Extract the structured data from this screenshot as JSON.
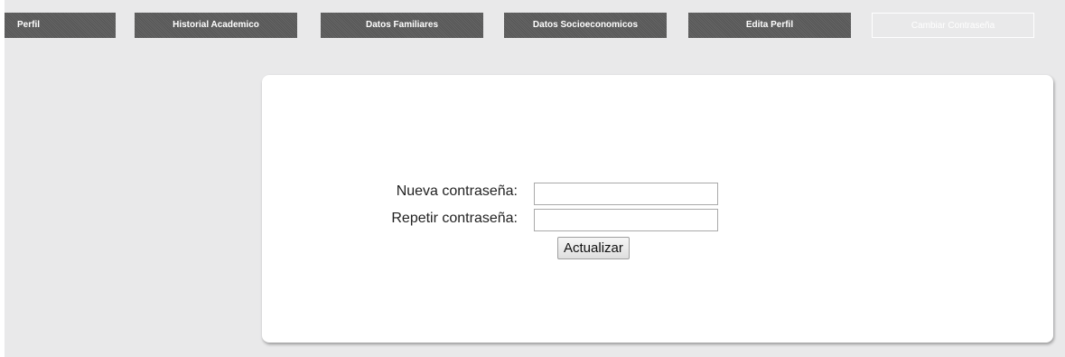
{
  "nav": {
    "tabs": [
      {
        "label": "Perfil",
        "active": false
      },
      {
        "label": "Historial Academico",
        "active": false
      },
      {
        "label": "Datos Familiares",
        "active": false
      },
      {
        "label": "Datos Socioeconomicos",
        "active": false
      },
      {
        "label": "Edita Perfil",
        "active": false
      },
      {
        "label": "Cambiar Contraseña",
        "active": true
      }
    ]
  },
  "form": {
    "new_password_label": "Nueva contraseña:",
    "new_password_value": "",
    "repeat_password_label": "Repetir contraseña:",
    "repeat_password_value": "",
    "submit_label": "Actualizar"
  },
  "colors": {
    "tab_bg": "#5a5a5a",
    "page_bg": "#e9e9ea",
    "card_bg": "#ffffff"
  }
}
